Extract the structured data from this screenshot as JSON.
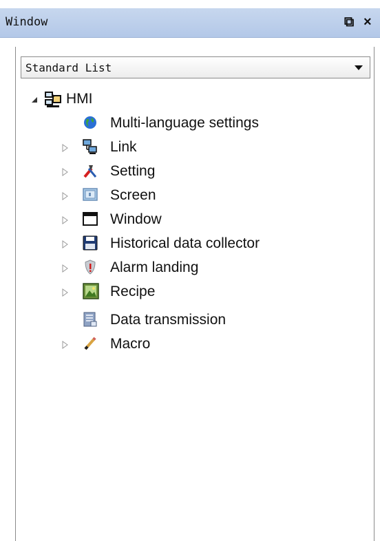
{
  "window": {
    "title": "Window",
    "pin_glyph": "⧉",
    "close_glyph": "×"
  },
  "view_selector": {
    "selected": "Standard List"
  },
  "tree": {
    "root": {
      "label": "HMI",
      "icon": "hmi-network-icon",
      "expanded": true
    },
    "items": [
      {
        "label": "Multi-language settings",
        "icon": "globe-icon",
        "has_children": false
      },
      {
        "label": "Link",
        "icon": "link-network-icon",
        "has_children": true
      },
      {
        "label": "Setting",
        "icon": "tools-icon",
        "has_children": true
      },
      {
        "label": "Screen",
        "icon": "screen-icon",
        "has_children": true
      },
      {
        "label": "Window",
        "icon": "window-icon",
        "has_children": true
      },
      {
        "label": "Historical data collector",
        "icon": "floppy-disk-icon",
        "has_children": true
      },
      {
        "label": "Alarm landing",
        "icon": "alarm-shield-icon",
        "has_children": true
      },
      {
        "label": "Recipe",
        "icon": "recipe-picture-icon",
        "has_children": true
      },
      {
        "label": "Data transmission",
        "icon": "data-transmission-icon",
        "has_children": false
      },
      {
        "label": "Macro",
        "icon": "pencil-macro-icon",
        "has_children": true
      }
    ]
  },
  "colors": {
    "titlebar": "#b8cbe9",
    "text": "#111111"
  }
}
